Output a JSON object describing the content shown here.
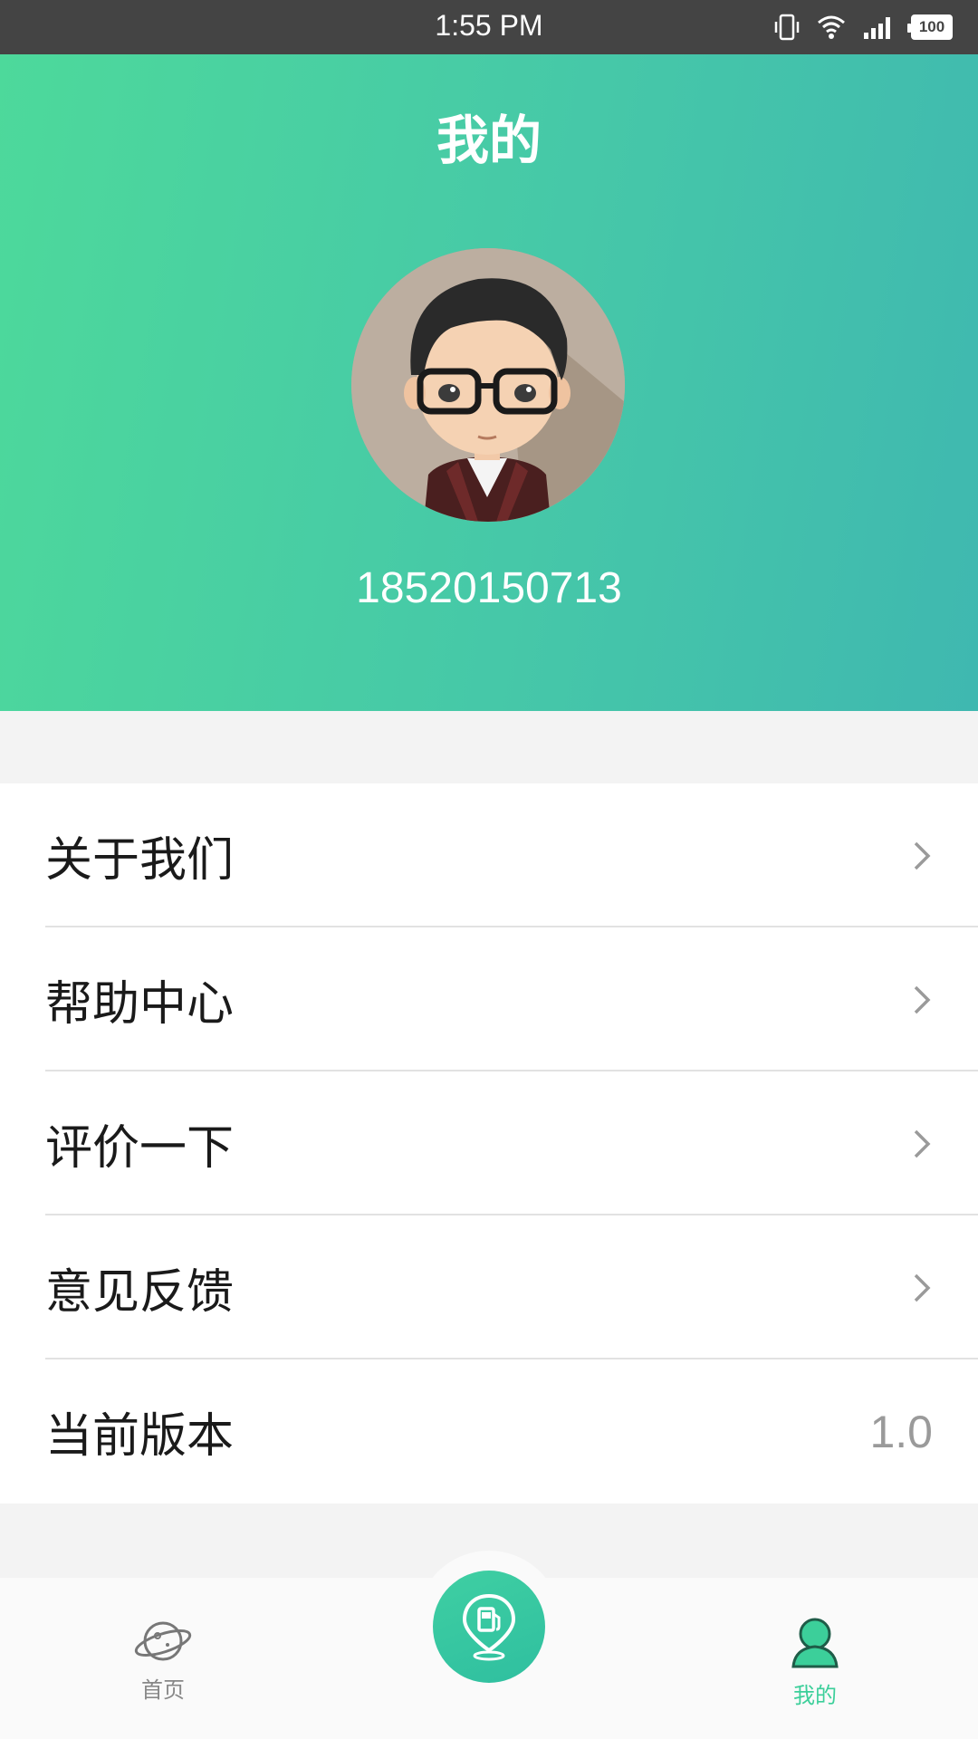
{
  "status_bar": {
    "time": "1:55 PM",
    "battery": "100",
    "icons": [
      "vibrate-icon",
      "wifi-icon",
      "signal-icon",
      "battery-icon"
    ]
  },
  "header": {
    "title": "我的",
    "phone": "18520150713",
    "gradient_start": "#4dd99b",
    "gradient_end": "#3fb8b0"
  },
  "menu": {
    "items": [
      {
        "label": "关于我们"
      },
      {
        "label": "帮助中心"
      },
      {
        "label": "评价一下"
      },
      {
        "label": "意见反馈"
      },
      {
        "label": "当前版本",
        "value": "1.0"
      }
    ]
  },
  "tabbar": {
    "home_label": "首页",
    "center_icon": "fuel-location-icon",
    "mine_label": "我的",
    "active_color": "#3ccf9a",
    "inactive_color": "#888888"
  }
}
